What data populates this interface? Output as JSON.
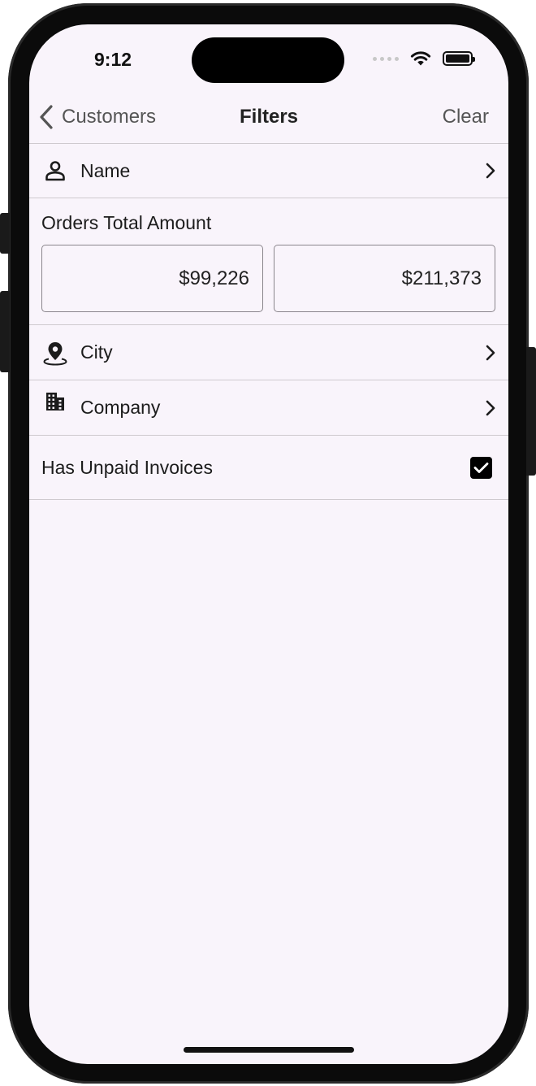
{
  "status_bar": {
    "time": "9:12"
  },
  "nav": {
    "back_label": "Customers",
    "title": "Filters",
    "clear_label": "Clear"
  },
  "filters": {
    "name": {
      "label": "Name",
      "icon": "person-icon"
    },
    "orders_total": {
      "label": "Orders Total Amount",
      "min_value": "$99,226",
      "max_value": "$211,373"
    },
    "city": {
      "label": "City",
      "icon": "map-pin-icon"
    },
    "company": {
      "label": "Company",
      "icon": "building-icon"
    },
    "unpaid": {
      "label": "Has Unpaid Invoices",
      "checked": true
    }
  },
  "colors": {
    "background": "#f9f4fb",
    "divider": "#cfcacf",
    "text": "#1c1c1c",
    "secondary_text": "#555555"
  }
}
